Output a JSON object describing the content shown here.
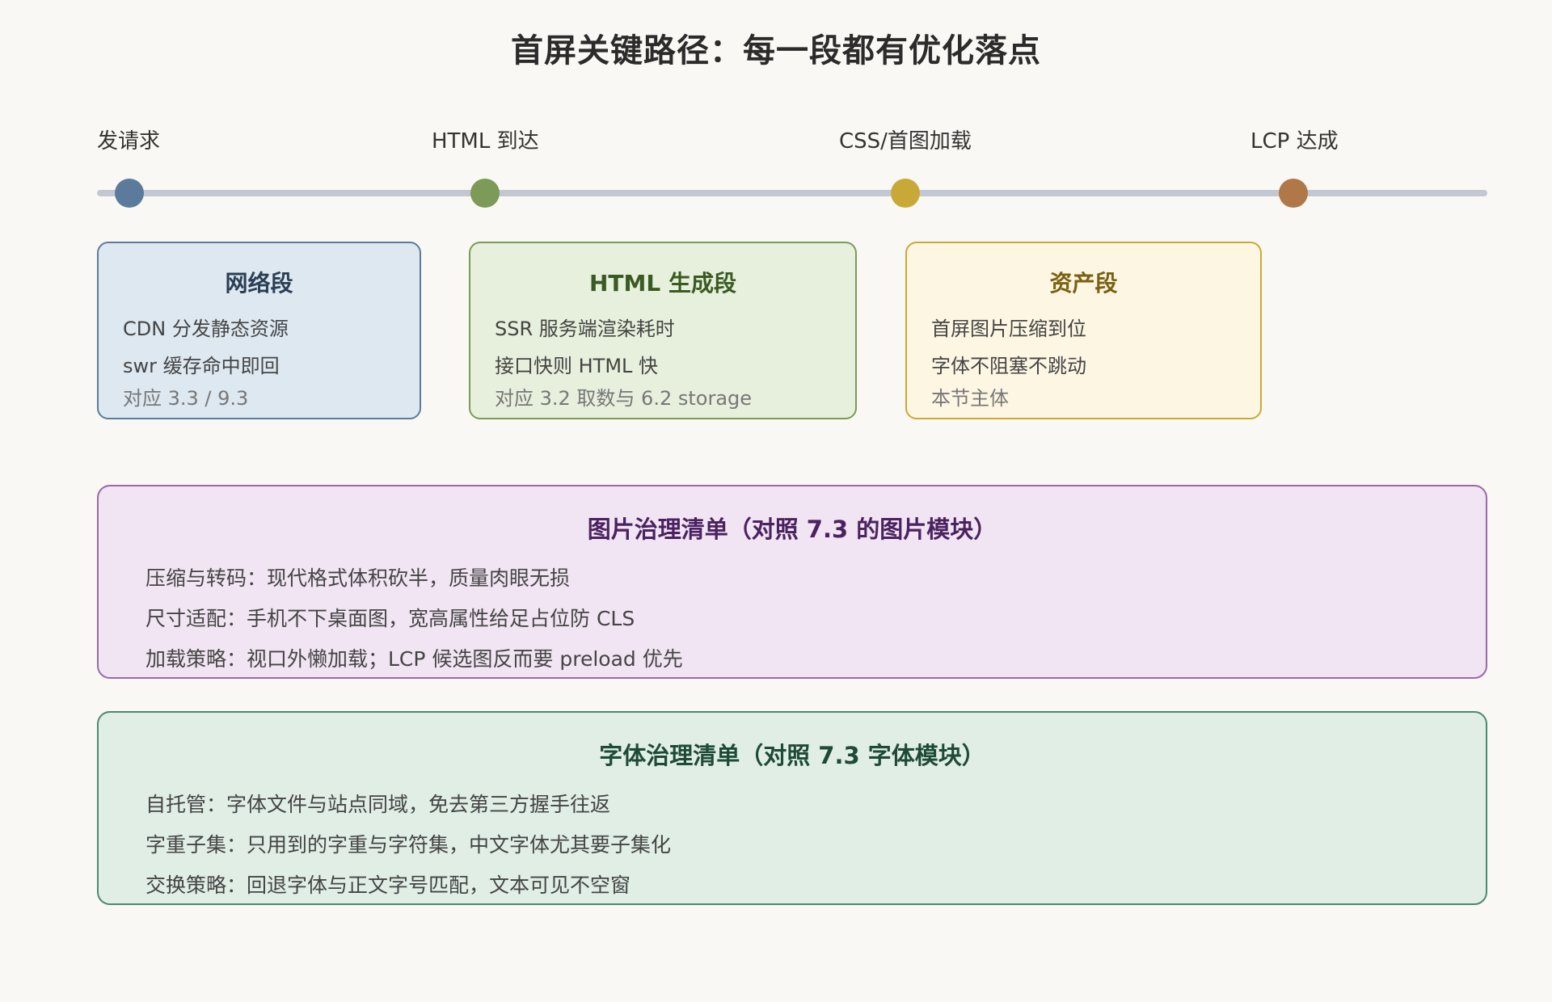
{
  "title": "首屏关键路径：每一段都有优化落点",
  "colors": {
    "background": "#faf8f4",
    "track": "#c2c8d2",
    "network": "#5c7b9c",
    "html": "#7c9a58",
    "assets": "#c8a938",
    "lcp": "#b07848"
  },
  "timeline": {
    "stages": [
      {
        "label": "发请求",
        "color": "#5c7b9c"
      },
      {
        "label": "HTML 到达",
        "color": "#7c9a58"
      },
      {
        "label": "CSS/首图加载",
        "color": "#c8a938"
      },
      {
        "label": "LCP 达成",
        "color": "#b07848"
      }
    ]
  },
  "segments": [
    {
      "title": "网络段",
      "lines": [
        "CDN 分发静态资源",
        "swr 缓存命中即回"
      ],
      "note": "对应 3.3 / 9.3",
      "bg": "#dde8f0",
      "border": "#5c7b9c",
      "title_color": "#2c3e55"
    },
    {
      "title": "HTML 生成段",
      "lines": [
        "SSR 服务端渲染耗时",
        "接口快则 HTML 快"
      ],
      "note": "对应 3.2 取数与 6.2 storage",
      "bg": "#e6f0dc",
      "border": "#7c9a58",
      "title_color": "#3a5a22"
    },
    {
      "title": "资产段",
      "lines": [
        "首屏图片压缩到位",
        "字体不阻塞不跳动"
      ],
      "note": "本节主体",
      "bg": "#fdf6e2",
      "border": "#c8a938",
      "title_color": "#7a6010"
    }
  ],
  "checklists": [
    {
      "title": "图片治理清单（对照 7.3 的图片模块）",
      "items": [
        "压缩与转码：现代格式体积砍半，质量肉眼无损",
        "尺寸适配：手机不下桌面图，宽高属性给足占位防 CLS",
        "加载策略：视口外懒加载；LCP 候选图反而要 preload 优先"
      ],
      "bg": "#f1e4f3",
      "border": "#9a6aa8",
      "title_color": "#4a2260"
    },
    {
      "title": "字体治理清单（对照 7.3 字体模块）",
      "items": [
        "自托管：字体文件与站点同域，免去第三方握手往返",
        "字重子集：只用到的字重与字符集，中文字体尤其要子集化",
        "交换策略：回退字体与正文字号匹配，文本可见不空窗"
      ],
      "bg": "#e0eee6",
      "border": "#4a8a70",
      "title_color": "#1e4a38"
    }
  ]
}
